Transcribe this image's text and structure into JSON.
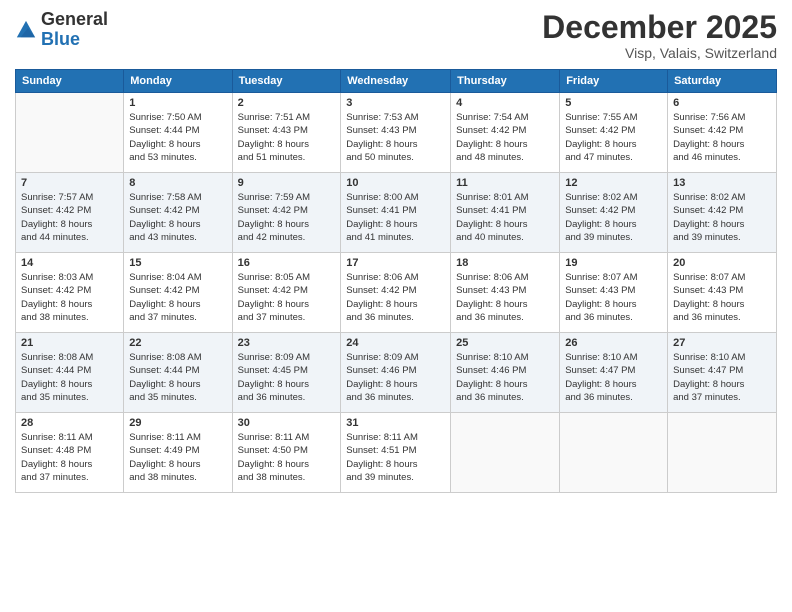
{
  "header": {
    "logo_general": "General",
    "logo_blue": "Blue",
    "month": "December 2025",
    "location": "Visp, Valais, Switzerland"
  },
  "days_of_week": [
    "Sunday",
    "Monday",
    "Tuesday",
    "Wednesday",
    "Thursday",
    "Friday",
    "Saturday"
  ],
  "weeks": [
    [
      {
        "day": "",
        "info": ""
      },
      {
        "day": "1",
        "info": "Sunrise: 7:50 AM\nSunset: 4:44 PM\nDaylight: 8 hours\nand 53 minutes."
      },
      {
        "day": "2",
        "info": "Sunrise: 7:51 AM\nSunset: 4:43 PM\nDaylight: 8 hours\nand 51 minutes."
      },
      {
        "day": "3",
        "info": "Sunrise: 7:53 AM\nSunset: 4:43 PM\nDaylight: 8 hours\nand 50 minutes."
      },
      {
        "day": "4",
        "info": "Sunrise: 7:54 AM\nSunset: 4:42 PM\nDaylight: 8 hours\nand 48 minutes."
      },
      {
        "day": "5",
        "info": "Sunrise: 7:55 AM\nSunset: 4:42 PM\nDaylight: 8 hours\nand 47 minutes."
      },
      {
        "day": "6",
        "info": "Sunrise: 7:56 AM\nSunset: 4:42 PM\nDaylight: 8 hours\nand 46 minutes."
      }
    ],
    [
      {
        "day": "7",
        "info": "Sunrise: 7:57 AM\nSunset: 4:42 PM\nDaylight: 8 hours\nand 44 minutes."
      },
      {
        "day": "8",
        "info": "Sunrise: 7:58 AM\nSunset: 4:42 PM\nDaylight: 8 hours\nand 43 minutes."
      },
      {
        "day": "9",
        "info": "Sunrise: 7:59 AM\nSunset: 4:42 PM\nDaylight: 8 hours\nand 42 minutes."
      },
      {
        "day": "10",
        "info": "Sunrise: 8:00 AM\nSunset: 4:41 PM\nDaylight: 8 hours\nand 41 minutes."
      },
      {
        "day": "11",
        "info": "Sunrise: 8:01 AM\nSunset: 4:41 PM\nDaylight: 8 hours\nand 40 minutes."
      },
      {
        "day": "12",
        "info": "Sunrise: 8:02 AM\nSunset: 4:42 PM\nDaylight: 8 hours\nand 39 minutes."
      },
      {
        "day": "13",
        "info": "Sunrise: 8:02 AM\nSunset: 4:42 PM\nDaylight: 8 hours\nand 39 minutes."
      }
    ],
    [
      {
        "day": "14",
        "info": "Sunrise: 8:03 AM\nSunset: 4:42 PM\nDaylight: 8 hours\nand 38 minutes."
      },
      {
        "day": "15",
        "info": "Sunrise: 8:04 AM\nSunset: 4:42 PM\nDaylight: 8 hours\nand 37 minutes."
      },
      {
        "day": "16",
        "info": "Sunrise: 8:05 AM\nSunset: 4:42 PM\nDaylight: 8 hours\nand 37 minutes."
      },
      {
        "day": "17",
        "info": "Sunrise: 8:06 AM\nSunset: 4:42 PM\nDaylight: 8 hours\nand 36 minutes."
      },
      {
        "day": "18",
        "info": "Sunrise: 8:06 AM\nSunset: 4:43 PM\nDaylight: 8 hours\nand 36 minutes."
      },
      {
        "day": "19",
        "info": "Sunrise: 8:07 AM\nSunset: 4:43 PM\nDaylight: 8 hours\nand 36 minutes."
      },
      {
        "day": "20",
        "info": "Sunrise: 8:07 AM\nSunset: 4:43 PM\nDaylight: 8 hours\nand 36 minutes."
      }
    ],
    [
      {
        "day": "21",
        "info": "Sunrise: 8:08 AM\nSunset: 4:44 PM\nDaylight: 8 hours\nand 35 minutes."
      },
      {
        "day": "22",
        "info": "Sunrise: 8:08 AM\nSunset: 4:44 PM\nDaylight: 8 hours\nand 35 minutes."
      },
      {
        "day": "23",
        "info": "Sunrise: 8:09 AM\nSunset: 4:45 PM\nDaylight: 8 hours\nand 36 minutes."
      },
      {
        "day": "24",
        "info": "Sunrise: 8:09 AM\nSunset: 4:46 PM\nDaylight: 8 hours\nand 36 minutes."
      },
      {
        "day": "25",
        "info": "Sunrise: 8:10 AM\nSunset: 4:46 PM\nDaylight: 8 hours\nand 36 minutes."
      },
      {
        "day": "26",
        "info": "Sunrise: 8:10 AM\nSunset: 4:47 PM\nDaylight: 8 hours\nand 36 minutes."
      },
      {
        "day": "27",
        "info": "Sunrise: 8:10 AM\nSunset: 4:47 PM\nDaylight: 8 hours\nand 37 minutes."
      }
    ],
    [
      {
        "day": "28",
        "info": "Sunrise: 8:11 AM\nSunset: 4:48 PM\nDaylight: 8 hours\nand 37 minutes."
      },
      {
        "day": "29",
        "info": "Sunrise: 8:11 AM\nSunset: 4:49 PM\nDaylight: 8 hours\nand 38 minutes."
      },
      {
        "day": "30",
        "info": "Sunrise: 8:11 AM\nSunset: 4:50 PM\nDaylight: 8 hours\nand 38 minutes."
      },
      {
        "day": "31",
        "info": "Sunrise: 8:11 AM\nSunset: 4:51 PM\nDaylight: 8 hours\nand 39 minutes."
      },
      {
        "day": "",
        "info": ""
      },
      {
        "day": "",
        "info": ""
      },
      {
        "day": "",
        "info": ""
      }
    ]
  ]
}
